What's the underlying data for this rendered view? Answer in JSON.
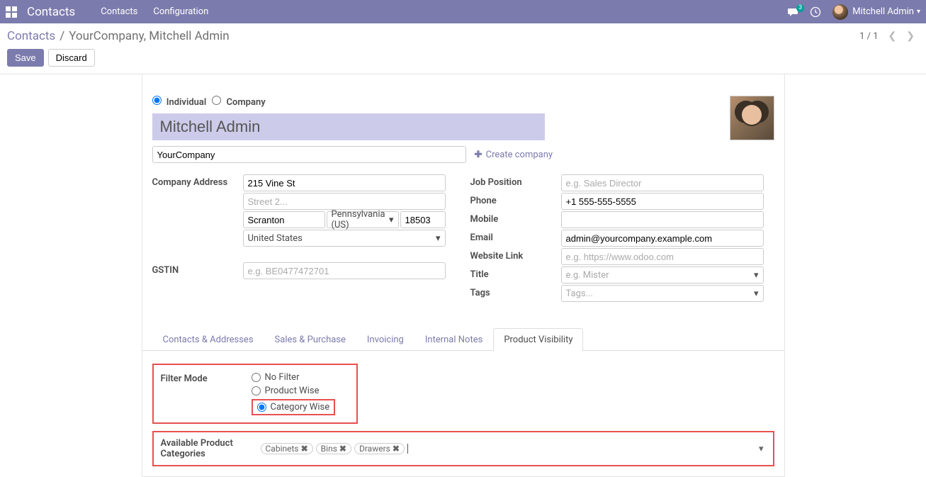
{
  "topbar": {
    "appname": "Contacts",
    "menu": {
      "contacts": "Contacts",
      "configuration": "Configuration"
    },
    "messages_badge": "3",
    "user_name": "Mitchell Admin"
  },
  "breadcrumb": {
    "root": "Contacts",
    "current": "YourCompany, Mitchell Admin"
  },
  "actions": {
    "save": "Save",
    "discard": "Discard"
  },
  "pager": {
    "text": "1 / 1"
  },
  "form": {
    "type": {
      "individual": "Individual",
      "company": "Company",
      "selected": "individual"
    },
    "name_value": "Mitchell Admin",
    "company_value": "YourCompany",
    "create_company": "Create company",
    "labels": {
      "company_address": "Company Address",
      "gstin": "GSTIN",
      "job_position": "Job Position",
      "phone": "Phone",
      "mobile": "Mobile",
      "email": "Email",
      "website": "Website Link",
      "title": "Title",
      "tags": "Tags"
    },
    "address": {
      "street": "215 Vine St",
      "street2_placeholder": "Street 2...",
      "city": "Scranton",
      "state": "Pennsylvania (US)",
      "zip": "18503",
      "country": "United States"
    },
    "gstin_placeholder": "e.g. BE0477472701",
    "job_position_placeholder": "e.g. Sales Director",
    "phone_value": "+1 555-555-5555",
    "mobile_value": "",
    "email_value": "admin@yourcompany.example.com",
    "website_placeholder": "e.g. https://www.odoo.com",
    "title_placeholder": "e.g. Mister",
    "tags_placeholder": "Tags..."
  },
  "tabs": {
    "contacts_addresses": "Contacts & Addresses",
    "sales_purchase": "Sales & Purchase",
    "invoicing": "Invoicing",
    "internal_notes": "Internal Notes",
    "product_visibility": "Product Visibility"
  },
  "product_visibility": {
    "filter_mode_label": "Filter Mode",
    "options": {
      "no_filter": "No Filter",
      "product_wise": "Product Wise",
      "category_wise": "Category Wise"
    },
    "apc_label": "Available Product Categories",
    "tags": [
      "Cabinets",
      "Bins",
      "Drawers"
    ]
  }
}
